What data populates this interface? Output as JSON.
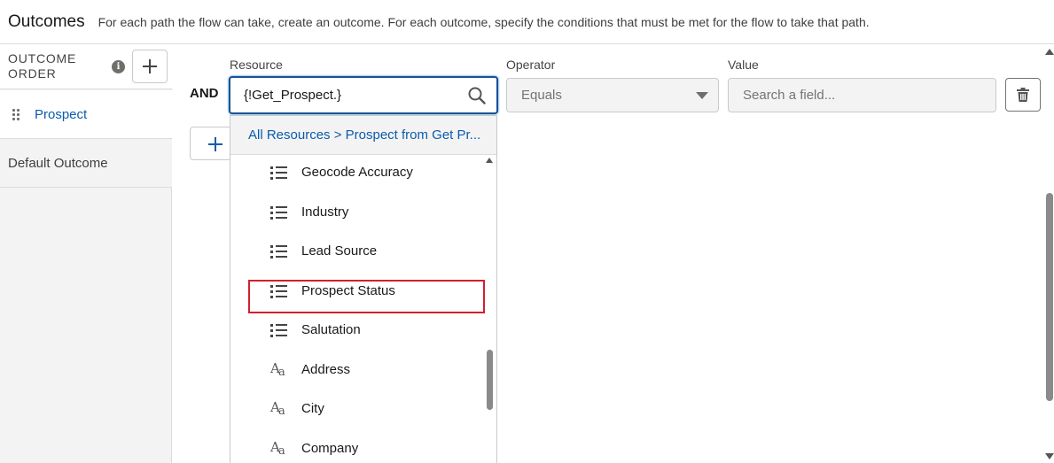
{
  "header": {
    "title": "Outcomes",
    "description": "For each path the flow can take, create an outcome. For each outcome, specify the conditions that must be met for the flow to take that path."
  },
  "sidebar": {
    "order_label": "OUTCOME ORDER",
    "outcomes": [
      {
        "label": "Prospect"
      },
      {
        "label": "Default Outcome"
      }
    ]
  },
  "condition": {
    "logic_label": "AND",
    "resource": {
      "label": "Resource",
      "value": "{!Get_Prospect.}"
    },
    "operator": {
      "label": "Operator",
      "value": "Equals"
    },
    "value": {
      "label": "Value",
      "placeholder": "Search a field..."
    }
  },
  "dropdown": {
    "breadcrumb": "All Resources > Prospect from Get Pr...",
    "items": [
      {
        "label": "Geocode Accuracy",
        "icon": "picklist-icon"
      },
      {
        "label": "Industry",
        "icon": "picklist-icon"
      },
      {
        "label": "Lead Source",
        "icon": "picklist-icon"
      },
      {
        "label": "Prospect Status",
        "icon": "picklist-icon",
        "highlighted": true
      },
      {
        "label": "Salutation",
        "icon": "picklist-icon"
      },
      {
        "label": "Address",
        "icon": "text-field-icon"
      },
      {
        "label": "City",
        "icon": "text-field-icon"
      },
      {
        "label": "Company",
        "icon": "text-field-icon"
      }
    ]
  },
  "colors": {
    "link": "#0b5cab",
    "focus_border": "#1b5297",
    "highlight": "#d0202f"
  }
}
